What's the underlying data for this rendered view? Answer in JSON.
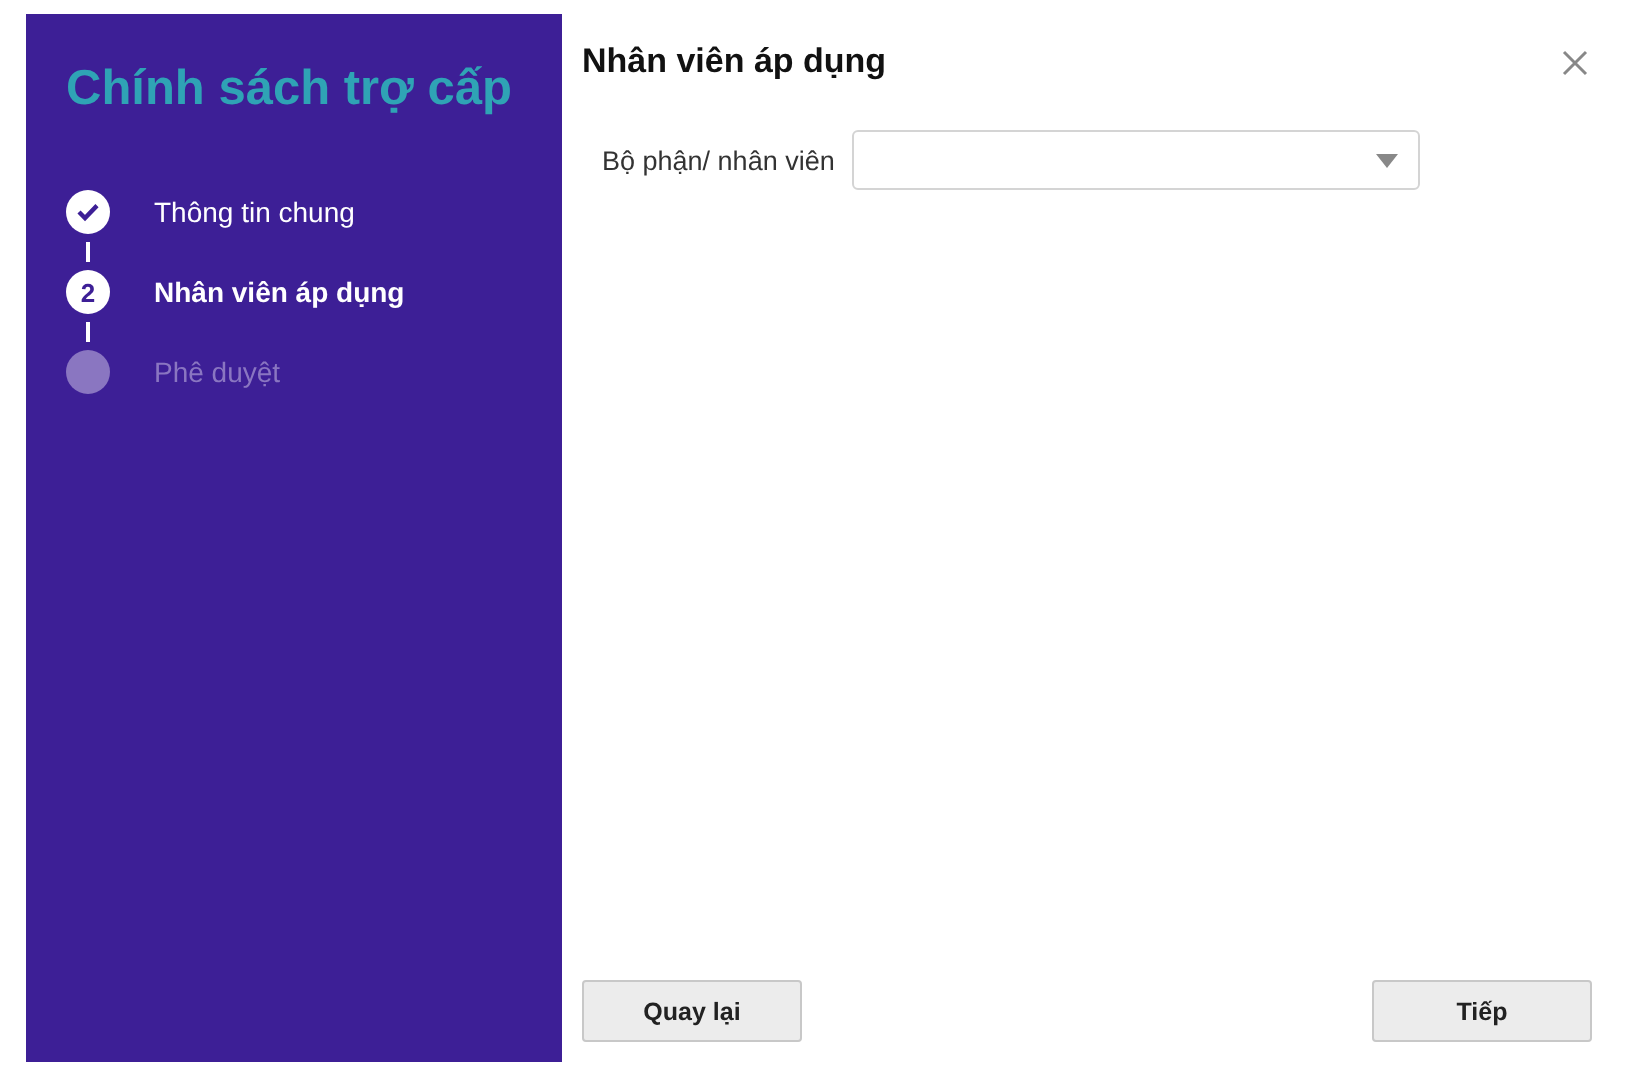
{
  "sidebar": {
    "title": "Chính sách trợ cấp",
    "steps": [
      {
        "label": "Thông tin chung",
        "done": true,
        "selected": false
      },
      {
        "label": "Nhân viên áp dụng",
        "done": false,
        "selected": true,
        "number": "2"
      },
      {
        "label": "Phê duyệt",
        "done": false,
        "selected": false
      }
    ]
  },
  "panel": {
    "title": "Nhân viên áp dụng",
    "field": {
      "label": "Bộ phận/ nhân viên"
    },
    "buttons": [
      "Quay lại",
      "Tiếp"
    ]
  }
}
